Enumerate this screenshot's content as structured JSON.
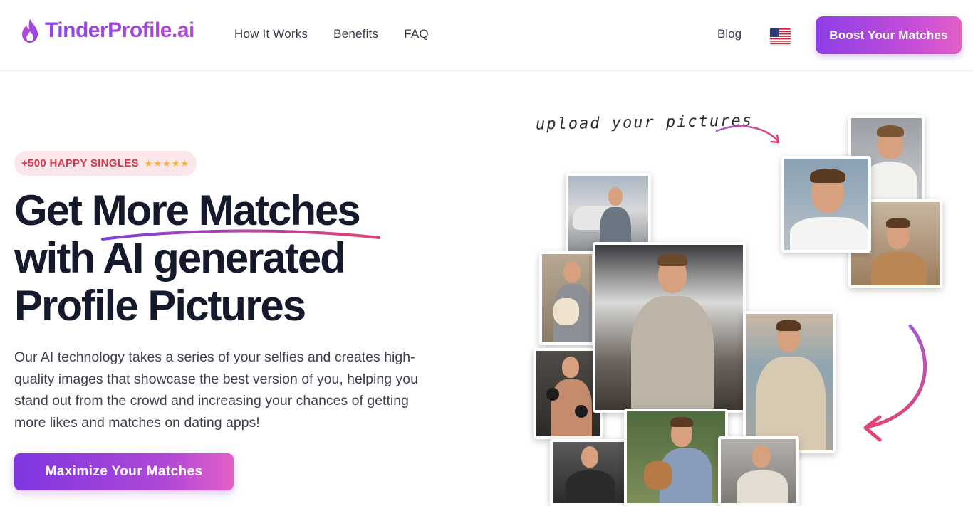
{
  "header": {
    "logo_text": "TinderProfile.ai",
    "nav": [
      "How It Works",
      "Benefits",
      "FAQ"
    ],
    "blog_label": "Blog",
    "language_flag": "us-flag-icon",
    "boost_button": "Boost Your Matches"
  },
  "hero": {
    "badge_text": "+500 HAPPY SINGLES",
    "badge_stars": "★★★★★",
    "headline_line1": "Get More Matches",
    "headline_line2": "with AI generated",
    "headline_line3": "Profile Pictures",
    "description": "Our AI technology takes a series of your selfies and creates high-quality images that showcase the best version of you, helping you stand out from the crowd and increasing your chances of getting more likes and matches on dating apps!",
    "cta_button": "Maximize Your Matches"
  },
  "collage": {
    "handwriting": "upload your pictures"
  },
  "colors": {
    "brand_purple": "#8e44e8",
    "brand_pink": "#e45fc6",
    "badge_bg": "#fbe6ea",
    "badge_text": "#d0384f",
    "star": "#f1b33b",
    "headline": "#141a2c"
  }
}
